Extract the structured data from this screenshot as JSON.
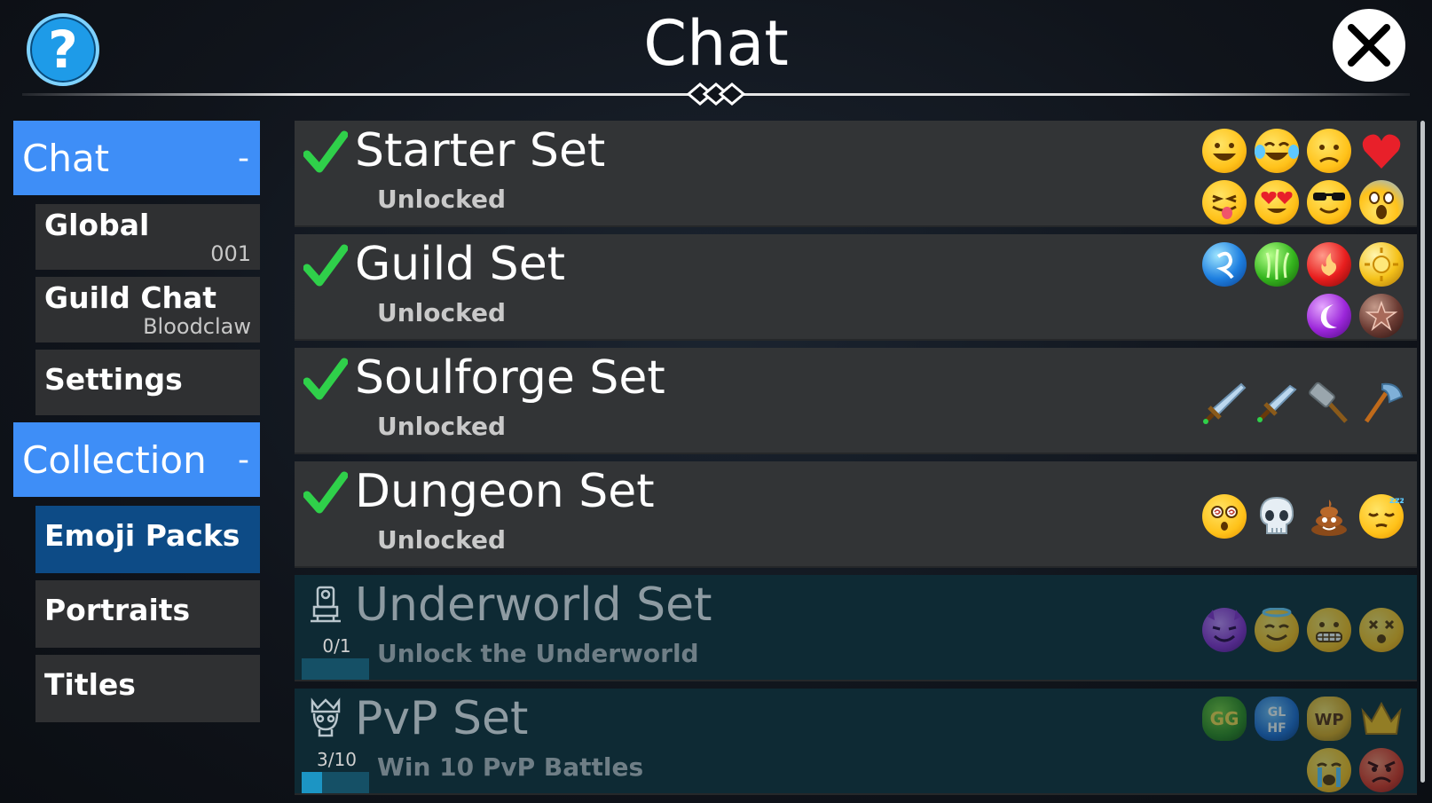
{
  "header": {
    "title": "Chat",
    "help_glyph": "?"
  },
  "sidebar": {
    "sections": [
      {
        "label": "Chat",
        "collapse": "-"
      },
      {
        "label": "Collection",
        "collapse": "-"
      }
    ],
    "chat_items": [
      {
        "label": "Global",
        "sub": "001"
      },
      {
        "label": "Guild Chat",
        "sub": "Bloodclaw"
      },
      {
        "label": "Settings",
        "sub": ""
      }
    ],
    "collection_items": [
      {
        "label": "Emoji Packs",
        "active": true
      },
      {
        "label": "Portraits"
      },
      {
        "label": "Titles"
      }
    ]
  },
  "sets": [
    {
      "name": "Starter Set",
      "status": "Unlocked",
      "unlocked": true,
      "emojis": [
        "grinning-face",
        "tears-of-joy-face",
        "worried-face",
        "red-heart",
        "tongue-out-face",
        "heart-eyes-face",
        "sunglasses-face",
        "screaming-face"
      ]
    },
    {
      "name": "Guild Set",
      "status": "Unlocked",
      "unlocked": true,
      "emojis": [
        "blue-water-orb",
        "green-nature-orb",
        "red-fire-orb",
        "yellow-light-orb",
        "purple-moon-orb",
        "brown-star-orb"
      ]
    },
    {
      "name": "Soulforge Set",
      "status": "Unlocked",
      "unlocked": true,
      "emojis": [
        "broadsword",
        "short-sword",
        "war-hammer",
        "axe"
      ]
    },
    {
      "name": "Dungeon Set",
      "status": "Unlocked",
      "unlocked": true,
      "emojis": [
        "dizzy-face",
        "skull",
        "poop",
        "sleeping-face"
      ]
    },
    {
      "name": "Underworld Set",
      "status": "Unlock the Underworld",
      "unlocked": false,
      "progress_text": "0/1",
      "progress": 0.0,
      "emojis": [
        "smiling-devil",
        "halo-face",
        "grimacing-face",
        "knocked-out-face"
      ]
    },
    {
      "name": "PvP Set",
      "status": "Win 10 PvP Battles",
      "unlocked": false,
      "progress_text": "3/10",
      "progress": 0.3,
      "emojis": [
        "gg-badge",
        "glhf-badge",
        "wp-badge",
        "crown",
        "crying-face",
        "angry-face"
      ]
    }
  ],
  "colors": {
    "accent": "#3e8ef7",
    "active_item": "#0d4b86",
    "check": "#2fd04a"
  }
}
